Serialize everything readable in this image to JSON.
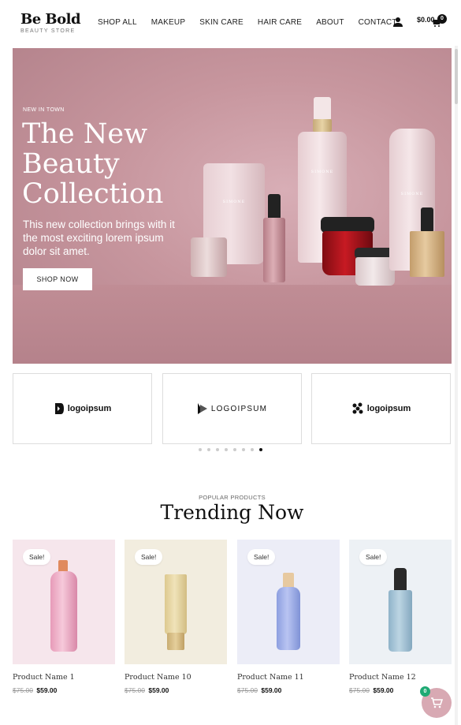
{
  "header": {
    "brand_name": "Be Bold",
    "brand_tagline": "BEAUTY STORE",
    "nav": [
      "SHOP ALL",
      "MAKEUP",
      "SKIN CARE",
      "HAIR CARE",
      "ABOUT",
      "CONTACT"
    ],
    "cart_price": "$0.00",
    "cart_count": "0"
  },
  "hero": {
    "eyebrow": "NEW IN TOWN",
    "title": "The New Beauty Collection",
    "text": "This new collection brings with it the most exciting lorem ipsum dolor sit amet.",
    "button": "SHOP NOW",
    "product_brand": "SIMONE"
  },
  "logos": [
    "logoipsum",
    "LOGOIPSUM",
    "logoipsum"
  ],
  "carousel": {
    "dots": 8,
    "active_index": 7
  },
  "trending": {
    "eyebrow": "POPULAR PRODUCTS",
    "title": "Trending Now",
    "sale_label": "Sale!",
    "products": [
      {
        "name": "Product Name 1",
        "old_price": "$75.00",
        "price": "$59.00",
        "bg": "#f6e6ec"
      },
      {
        "name": "Product Name 10",
        "old_price": "$75.00",
        "price": "$59.00",
        "bg": "#f2eddf"
      },
      {
        "name": "Product Name 11",
        "old_price": "$75.00",
        "price": "$59.00",
        "bg": "#ecedf7"
      },
      {
        "name": "Product Name 12",
        "old_price": "$75.00",
        "price": "$59.00",
        "bg": "#edf1f5"
      }
    ]
  },
  "floating_cart": {
    "count": "0"
  },
  "colors": {
    "hero_bg": "#c7969e",
    "accent": "#d8a9b3",
    "badge_green": "#1faa74"
  }
}
